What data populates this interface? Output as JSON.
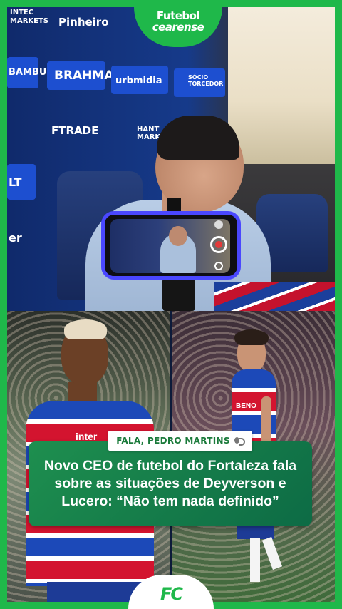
{
  "brand": {
    "line1": "Futebol",
    "line2": "cearense",
    "badge": "FC"
  },
  "backdrop_sponsors": {
    "intec": "INTEC",
    "markets": "MARKETS",
    "pinheiro": "Pinheiro",
    "bambu": "BAMBU",
    "brahma": "BRAHMA",
    "urbmidia": "urbmidia",
    "socio": "SÓCIO",
    "torcedor": "TORCEDOR",
    "ftrade": "FTRADE",
    "hant": "HANT",
    "mark": "MARK",
    "lt": "LT",
    "er": "er"
  },
  "jersey": {
    "sponsor": "inter",
    "sponsor2": "BENO"
  },
  "caption": {
    "byline": "FALA, PEDRO MARTINS",
    "headline": "Novo CEO de futebol do Fortaleza fala sobre as situações de Deyverson e Lucero: “Não tem nada definido”"
  },
  "colors": {
    "accent": "#1fb84a",
    "headline_bg": "#0d6b45",
    "backdrop_blue": "#163a8a",
    "record_red": "#e43a3a"
  },
  "icons": [
    "microphone-icon",
    "record-icon"
  ]
}
